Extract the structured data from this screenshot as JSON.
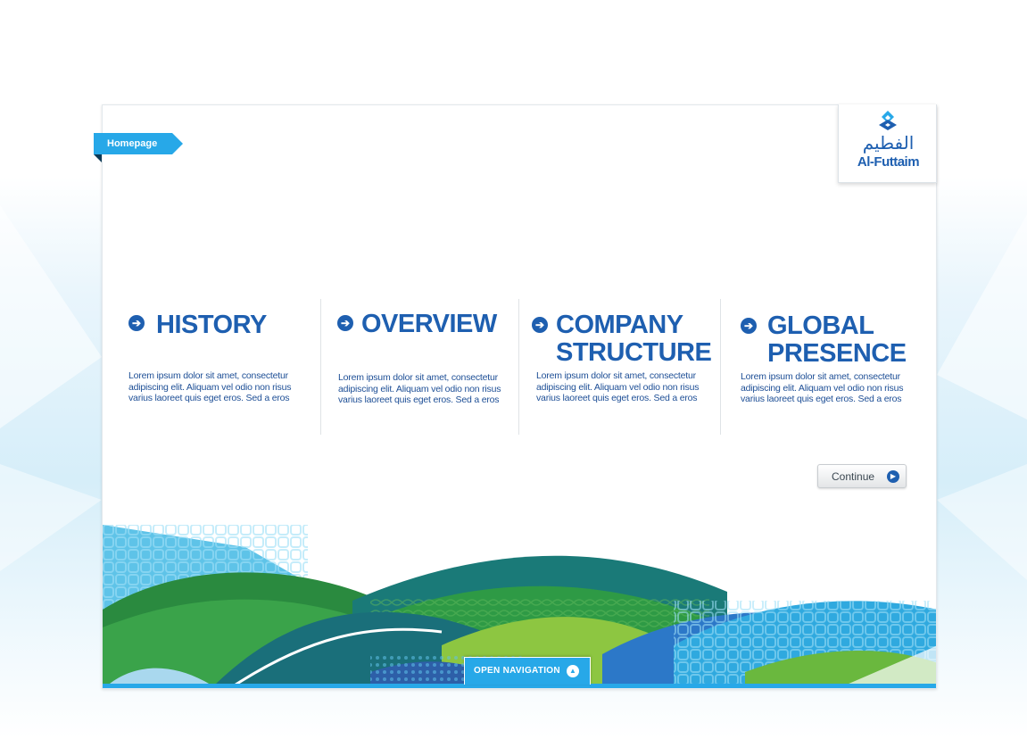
{
  "ribbon": {
    "label": "Homepage"
  },
  "logo": {
    "arabic": "الفطيم",
    "latin": "Al-Futtaim"
  },
  "sections": [
    {
      "title": "HISTORY",
      "body": "Lorem ipsum dolor sit amet, consectetur adipiscing elit. Aliquam vel odio non risus varius laoreet quis eget eros. Sed a eros"
    },
    {
      "title": "OVERVIEW",
      "body": "Lorem ipsum dolor sit amet, consectetur adipiscing elit. Aliquam vel odio non risus varius laoreet quis eget eros. Sed a eros"
    },
    {
      "title": "COMPANY\nSTRUCTURE",
      "body": "Lorem ipsum dolor sit amet, consectetur adipiscing elit. Aliquam vel odio non risus varius laoreet quis eget eros. Sed a eros"
    },
    {
      "title": "GLOBAL\nPRESENCE",
      "body": "Lorem ipsum dolor sit amet, consectetur adipiscing elit. Aliquam vel odio non risus varius laoreet quis eget eros. Sed a eros"
    }
  ],
  "continue_button": {
    "label": "Continue"
  },
  "nav_button": {
    "label": "OPEN NAVIGATION"
  },
  "icons": {
    "section_arrow": "arrow-right-circle-icon",
    "continue": "play-circle-icon",
    "nav": "chevron-up-circle-icon",
    "logo": "al-futtaim-emblem-icon"
  },
  "colors": {
    "brand_blue": "#1e5fb0",
    "accent_blue": "#27a8e8",
    "green": "#2e9a45",
    "teal": "#1a7a78"
  }
}
